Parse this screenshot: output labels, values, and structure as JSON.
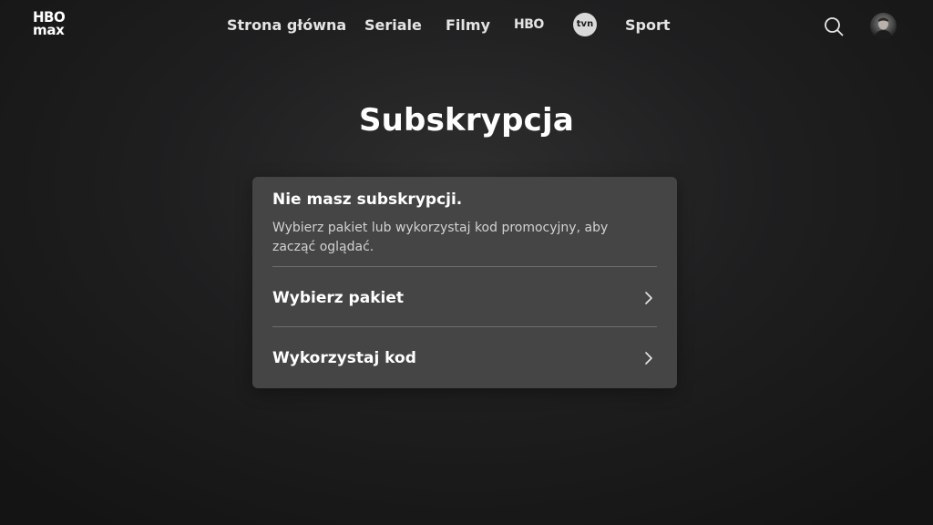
{
  "header": {
    "logo": {
      "line1": "HBO",
      "line2": "max"
    },
    "nav": [
      {
        "label": "Strona główna"
      },
      {
        "label": "Seriale"
      },
      {
        "label": "Filmy"
      },
      {
        "label": "HBO"
      },
      {
        "label": "tvn"
      },
      {
        "label": "Sport"
      }
    ],
    "icons": {
      "search": "search-icon",
      "profile": "avatar"
    }
  },
  "main": {
    "title": "Subskrypcja",
    "card": {
      "heading": "Nie masz subskrypcji.",
      "description": "Wybierz pakiet lub wykorzystaj kod promocyjny, aby zacząć oglądać.",
      "options": [
        {
          "label": "Wybierz pakiet",
          "icon": "chevron-right-icon"
        },
        {
          "label": "Wykorzystaj kod",
          "icon": "chevron-right-icon"
        }
      ]
    }
  },
  "colors": {
    "background": "#1f1f20",
    "card": "#454546",
    "text": "#ffffff",
    "muted_text": "#d2d2d2",
    "divider": "#6d6d6e"
  }
}
